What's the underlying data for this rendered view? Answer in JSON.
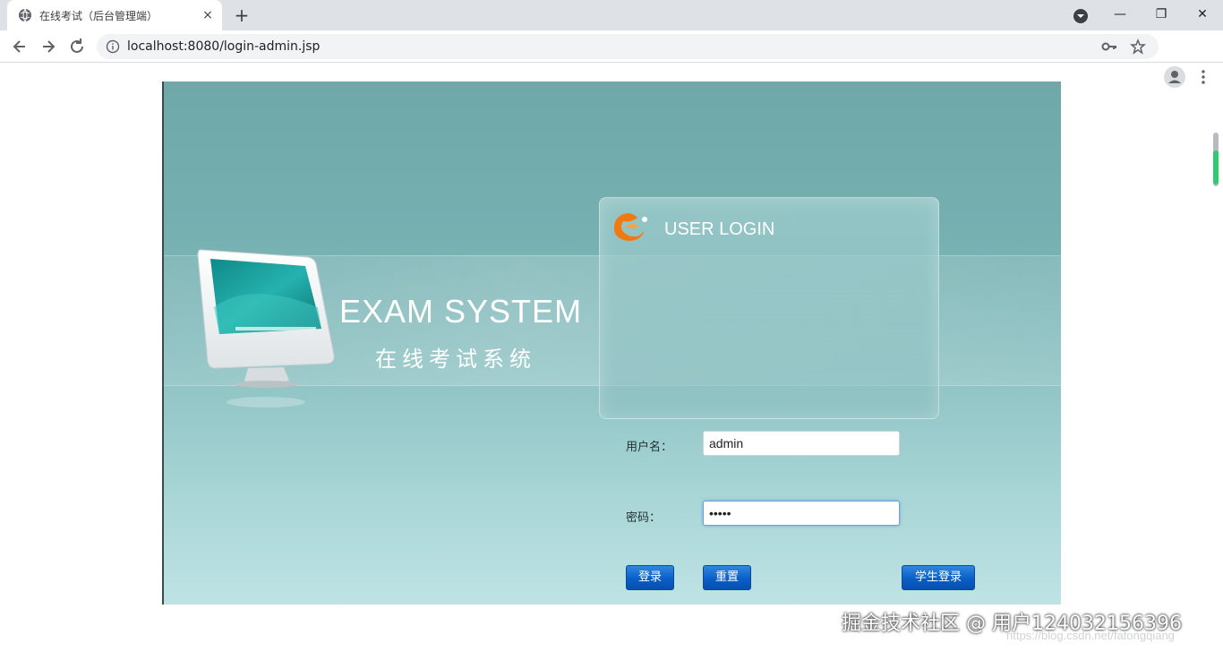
{
  "browser": {
    "tab_title": "在线考试（后台管理端）",
    "tab_close": "×",
    "new_tab": "+",
    "url": "localhost:8080/login-admin.jsp",
    "window_controls": {
      "minimize": "—",
      "restore": "❐",
      "close": "✕"
    }
  },
  "hero": {
    "title": "EXAM SYSTEM",
    "subtitle": "在线考试系统"
  },
  "login": {
    "panel_title": "USER LOGIN",
    "username_label": "用户名：",
    "username_value": "admin",
    "password_label": "密码：",
    "password_value": "•••••",
    "login_button": "登录",
    "reset_button": "重置",
    "student_login_button": "学生登录"
  },
  "watermark": {
    "text": "掘金技术社区 @ 用户1240321563​96",
    "url": "https://blog.csdn.net/fatongqiang"
  },
  "colors": {
    "button_blue": "#0a5fc6",
    "stage_teal": "#6fa8a8",
    "logo_orange": "#f07a10"
  }
}
